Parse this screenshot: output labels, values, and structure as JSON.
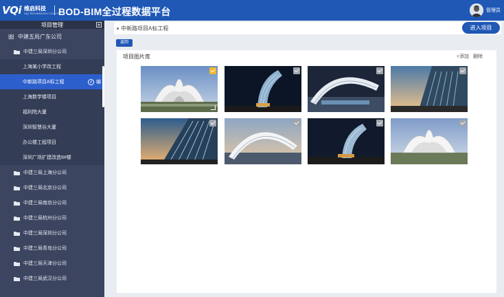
{
  "header": {
    "logo_mark": "VQi",
    "logo_cn": "维启科技",
    "logo_en": "VQI TECHNOLOGY CO.,LTD",
    "title": "BOD-BIM全过程数据平台",
    "username": "管理员"
  },
  "sidebar": {
    "title": "项目管理",
    "root": "中建五局广东公司",
    "groups": [
      {
        "label": "中建三局深圳分公司",
        "children": [
          "上海某小学改工程",
          "中新路项目A标工程",
          "上海数学楼项目",
          "福利院大厦",
          "深圳智慧谷大厦",
          "办公楼工程项目",
          "深圳广场扩建改造8#楼"
        ],
        "active_index": 1,
        "active_action": "编"
      },
      {
        "label": "中建三局上海分公司"
      },
      {
        "label": "中建三局北京分公司"
      },
      {
        "label": "中建三局南京分公司"
      },
      {
        "label": "中建三局杭州分公司"
      },
      {
        "label": "中建三局深圳分公司"
      },
      {
        "label": "中建三局青岛分公司"
      },
      {
        "label": "中建三局天津分公司"
      },
      {
        "label": "中建三局武汉分公司"
      }
    ]
  },
  "main": {
    "breadcrumb": "中新路项目A标工程",
    "enter_button": "进入项目",
    "back_button": "返回",
    "panel_title": "项目图片库",
    "actions": {
      "upload": "+添加",
      "delete": "删除"
    },
    "images": [
      {
        "name": "lotus-building-day",
        "selected": true
      },
      {
        "name": "curved-tower-night",
        "selected": false
      },
      {
        "name": "arch-structure-dusk",
        "selected": false
      },
      {
        "name": "glass-facade-sunset",
        "selected": false
      },
      {
        "name": "glass-facade-sunset-2",
        "selected": false
      },
      {
        "name": "arch-structure-dusk-2",
        "selected": false
      },
      {
        "name": "curved-tower-night-2",
        "selected": false
      },
      {
        "name": "lotus-building-day-2",
        "selected": false
      }
    ]
  }
}
